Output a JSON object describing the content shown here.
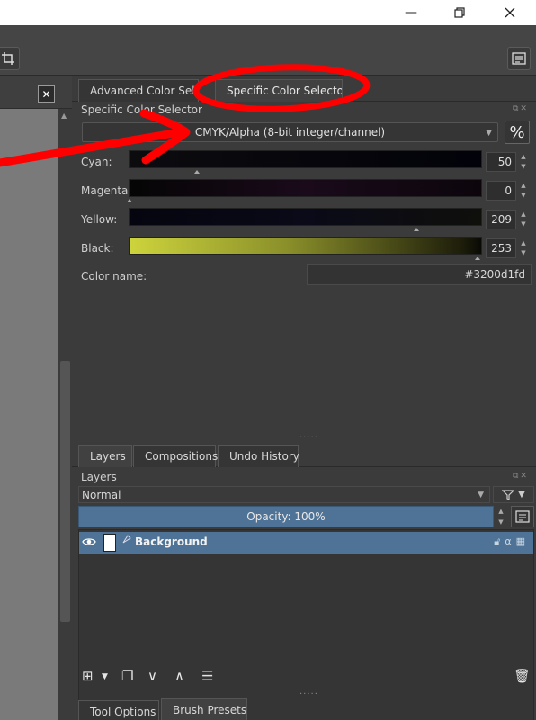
{
  "window": {
    "minimize_glyph": "—",
    "colors": {
      "titlebar": "#ffffff",
      "panel": "#3b3b3b",
      "highlight": "#4f7396",
      "annotation": "#ff0000"
    }
  },
  "color_docker": {
    "tabs": [
      {
        "label": "Advanced Color Selector"
      },
      {
        "label": "Specific Color Selector"
      }
    ],
    "title": "Specific Color Selector",
    "model": "CMYK/Alpha (8-bit integer/channel)",
    "percent_label": "%",
    "channels": [
      {
        "label": "Cyan:",
        "value": "50"
      },
      {
        "label": "Magenta:",
        "value": "0"
      },
      {
        "label": "Yellow:",
        "value": "209"
      },
      {
        "label": "Black:",
        "value": "253"
      }
    ],
    "color_name_label": "Color name:",
    "color_name_value": "#3200d1fd"
  },
  "layers_docker": {
    "tabs": [
      {
        "label": "Layers"
      },
      {
        "label": "Compositions"
      },
      {
        "label": "Undo History"
      }
    ],
    "title": "Layers",
    "blend_mode": "Normal",
    "opacity": "Opacity:  100%",
    "layers": [
      {
        "name": "Background"
      }
    ]
  },
  "bottom_tabs": [
    {
      "label": "Tool Options"
    },
    {
      "label": "Brush Presets"
    }
  ],
  "icons": [
    "minimize-icon",
    "restore-icon",
    "close-icon",
    "crop-icon",
    "docker-menu-icon",
    "eye-icon",
    "add-layer-icon",
    "duplicate-icon",
    "move-down-icon",
    "move-up-icon",
    "properties-icon",
    "trash-icon",
    "filter-icon",
    "lock-icon",
    "alpha-icon",
    "alpha-lock-icon"
  ]
}
